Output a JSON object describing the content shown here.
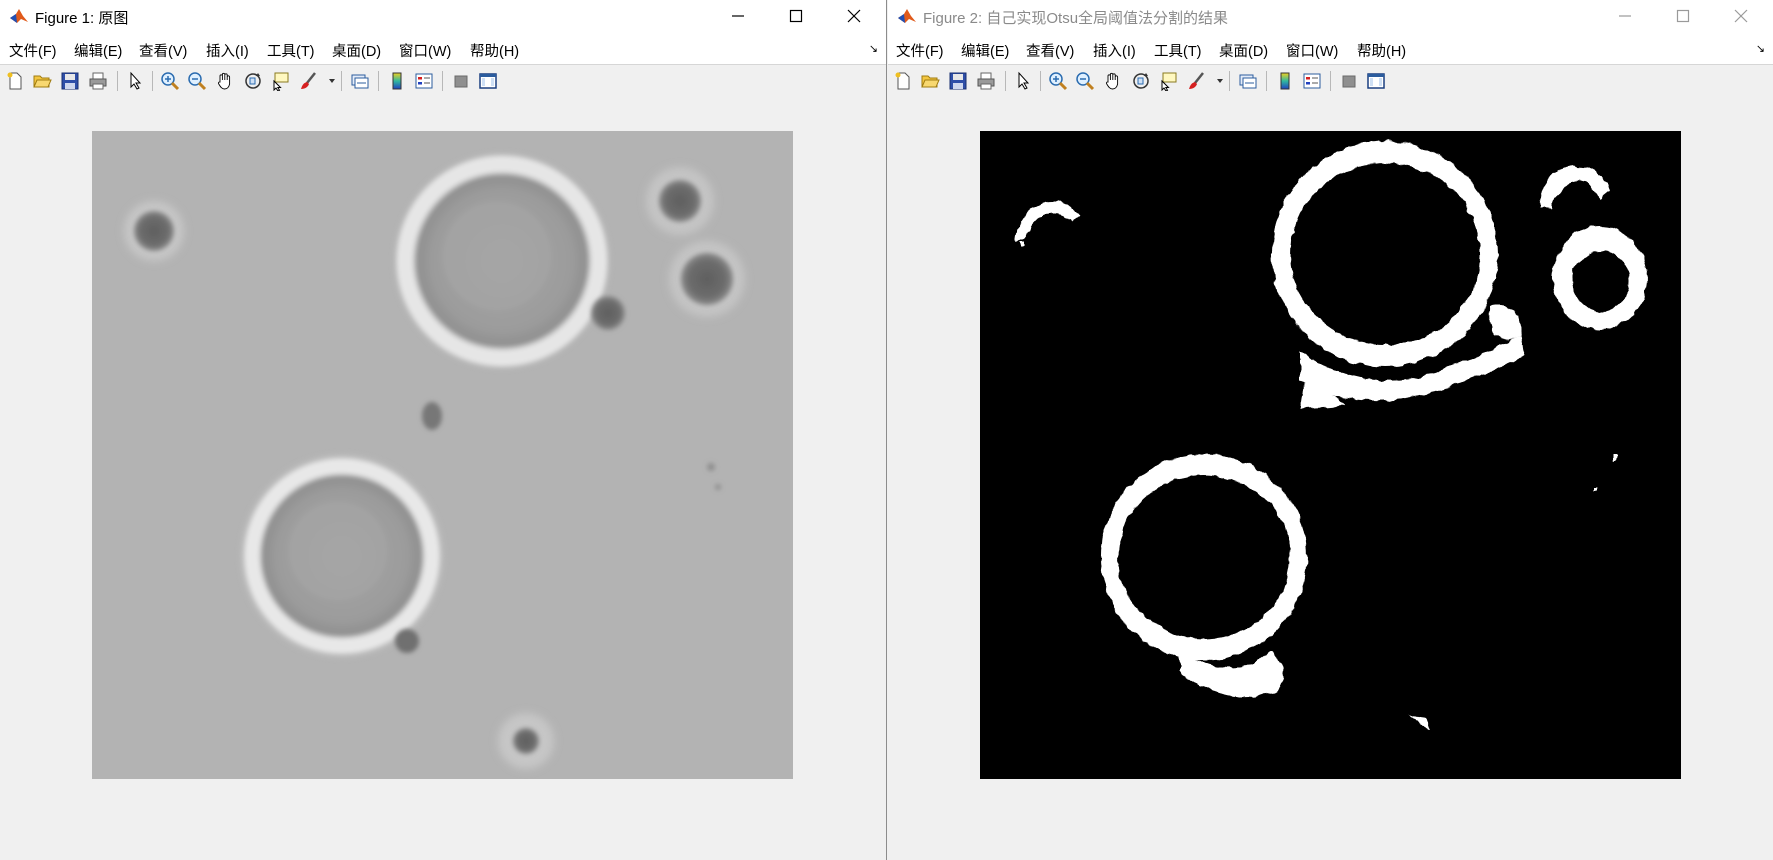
{
  "windows": [
    {
      "title": "Figure 1: 原图",
      "active": true,
      "menu": [
        "文件(F)",
        "编辑(E)",
        "查看(V)",
        "插入(I)",
        "工具(T)",
        "桌面(D)",
        "窗口(W)",
        "帮助(H)"
      ],
      "image": "grayscale microscopy image of cells"
    },
    {
      "title": "Figure 2: 自己实现Otsu全局阈值法分割的结果",
      "active": false,
      "menu": [
        "文件(F)",
        "编辑(E)",
        "查看(V)",
        "插入(I)",
        "工具(T)",
        "桌面(D)",
        "窗口(W)",
        "帮助(H)"
      ],
      "image": "binary segmentation result"
    }
  ],
  "icons": {
    "window_controls": [
      "minimize-icon",
      "maximize-icon",
      "close-icon"
    ],
    "toolbar": [
      "new-figure-icon",
      "open-file-icon",
      "save-icon",
      "print-icon",
      "pointer-icon",
      "zoom-in-icon",
      "zoom-out-icon",
      "pan-icon",
      "rotate-3d-icon",
      "data-cursor-icon",
      "brush-icon",
      "link-plot-icon",
      "colorbar-icon",
      "legend-icon",
      "hide-plot-tools-icon",
      "show-plot-tools-icon"
    ]
  },
  "colors": {
    "matlab_orange": "#e05a1b",
    "matlab_blue": "#1f4fb4"
  }
}
